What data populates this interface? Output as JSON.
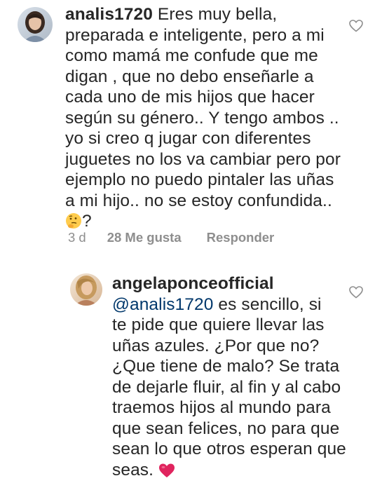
{
  "comments": [
    {
      "username": "analis1720",
      "avatar_icon": "profile-photo-woman",
      "lines": [
        "Eres muy bella,",
        "preparada e inteligente, pero a mi",
        "como mamá me confude que me",
        "digan , que no debo enseñarle a",
        "cada uno de mis hijos que hacer",
        "según su género.. Y tengo ambos ..",
        "yo si creo q jugar con diferentes",
        "juguetes no los va cambiar pero por",
        "ejemplo no puedo pintaler las uñas",
        "a mi hijo.. no se estoy confundida.."
      ],
      "last_line_suffix": "?",
      "emoji_icon": "thinking-face-icon",
      "time": "3 d",
      "likes": "28 Me gusta",
      "reply_label": "Responder"
    },
    {
      "username": "angelaponceofficial",
      "avatar_icon": "profile-photo-woman-blonde",
      "mention": "@analis1720",
      "lines": [
        " es sencillo, si",
        "te pide que quiere llevar las",
        "uñas azules. ¿Por que no?",
        "¿Que tiene de malo? Se trata",
        "de dejarle fluir, al fin y al cabo",
        "traemos hijos al mundo para",
        "que sean felices, no para que",
        "sean lo que otros esperan que",
        "seas."
      ],
      "emoji_icon": "red-heart-icon"
    }
  ],
  "colors": {
    "text": "#262626",
    "meta": "#8e8e8e",
    "mention": "#00376b",
    "heart": "#e0245e"
  }
}
